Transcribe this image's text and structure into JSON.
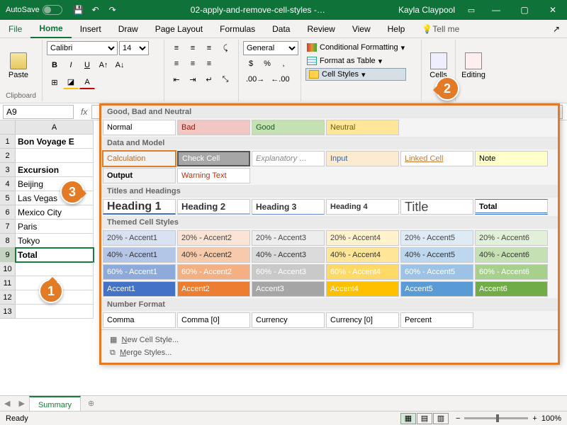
{
  "titlebar": {
    "autosave": "AutoSave",
    "filename": "02-apply-and-remove-cell-styles -…",
    "user": "Kayla Claypool"
  },
  "tabs": {
    "file": "File",
    "home": "Home",
    "insert": "Insert",
    "draw": "Draw",
    "pagelayout": "Page Layout",
    "formulas": "Formulas",
    "data": "Data",
    "review": "Review",
    "view": "View",
    "help": "Help",
    "tell": "Tell me"
  },
  "ribbon": {
    "clipboard": "Clipboard",
    "paste": "Paste",
    "font": "Calibri",
    "size": "14",
    "numberformat": "General",
    "conditional": "Conditional Formatting",
    "formatas": "Format as Table",
    "cellstyles": "Cell Styles",
    "cells": "Cells",
    "editing": "Editing"
  },
  "namebox": "A9",
  "grid": {
    "cols": [
      "A"
    ],
    "rows": [
      {
        "n": "1",
        "v": "Bon Voyage E",
        "bold": true
      },
      {
        "n": "2",
        "v": ""
      },
      {
        "n": "3",
        "v": "Excursion",
        "bold": true
      },
      {
        "n": "4",
        "v": "Beijing"
      },
      {
        "n": "5",
        "v": "Las Vegas"
      },
      {
        "n": "6",
        "v": "Mexico City"
      },
      {
        "n": "7",
        "v": "Paris"
      },
      {
        "n": "8",
        "v": "Tokyo"
      },
      {
        "n": "9",
        "v": "Total",
        "bold": true,
        "selected": true
      },
      {
        "n": "10",
        "v": ""
      },
      {
        "n": "11",
        "v": ""
      },
      {
        "n": "12",
        "v": ""
      },
      {
        "n": "13",
        "v": ""
      }
    ]
  },
  "styles": {
    "sec1": "Good, Bad and Neutral",
    "sec2": "Data and Model",
    "sec3": "Titles and Headings",
    "sec4": "Themed Cell Styles",
    "sec5": "Number Format",
    "normal": "Normal",
    "bad": "Bad",
    "good": "Good",
    "neutral": "Neutral",
    "calc": "Calculation",
    "check": "Check Cell",
    "expl": "Explanatory …",
    "input": "Input",
    "linked": "Linked Cell",
    "note": "Note",
    "output": "Output",
    "warn": "Warning Text",
    "h1": "Heading 1",
    "h2": "Heading 2",
    "h3": "Heading 3",
    "h4": "Heading 4",
    "title": "Title",
    "total": "Total",
    "a20": [
      "20% - Accent1",
      "20% - Accent2",
      "20% - Accent3",
      "20% - Accent4",
      "20% - Accent5",
      "20% - Accent6"
    ],
    "a40": [
      "40% - Accent1",
      "40% - Accent2",
      "40% - Accent3",
      "40% - Accent4",
      "40% - Accent5",
      "40% - Accent6"
    ],
    "a60": [
      "60% - Accent1",
      "60% - Accent2",
      "60% - Accent3",
      "60% - Accent4",
      "60% - Accent5",
      "60% - Accent6"
    ],
    "a100": [
      "Accent1",
      "Accent2",
      "Accent3",
      "Accent4",
      "Accent5",
      "Accent6"
    ],
    "nf": [
      "Comma",
      "Comma [0]",
      "Currency",
      "Currency [0]",
      "Percent"
    ],
    "newcell": "New Cell Style...",
    "merge": "Merge Styles..."
  },
  "sheet": {
    "name": "Summary"
  },
  "status": {
    "ready": "Ready",
    "zoom": "100%"
  },
  "callouts": {
    "c1": "1",
    "c2": "2",
    "c3": "3"
  }
}
